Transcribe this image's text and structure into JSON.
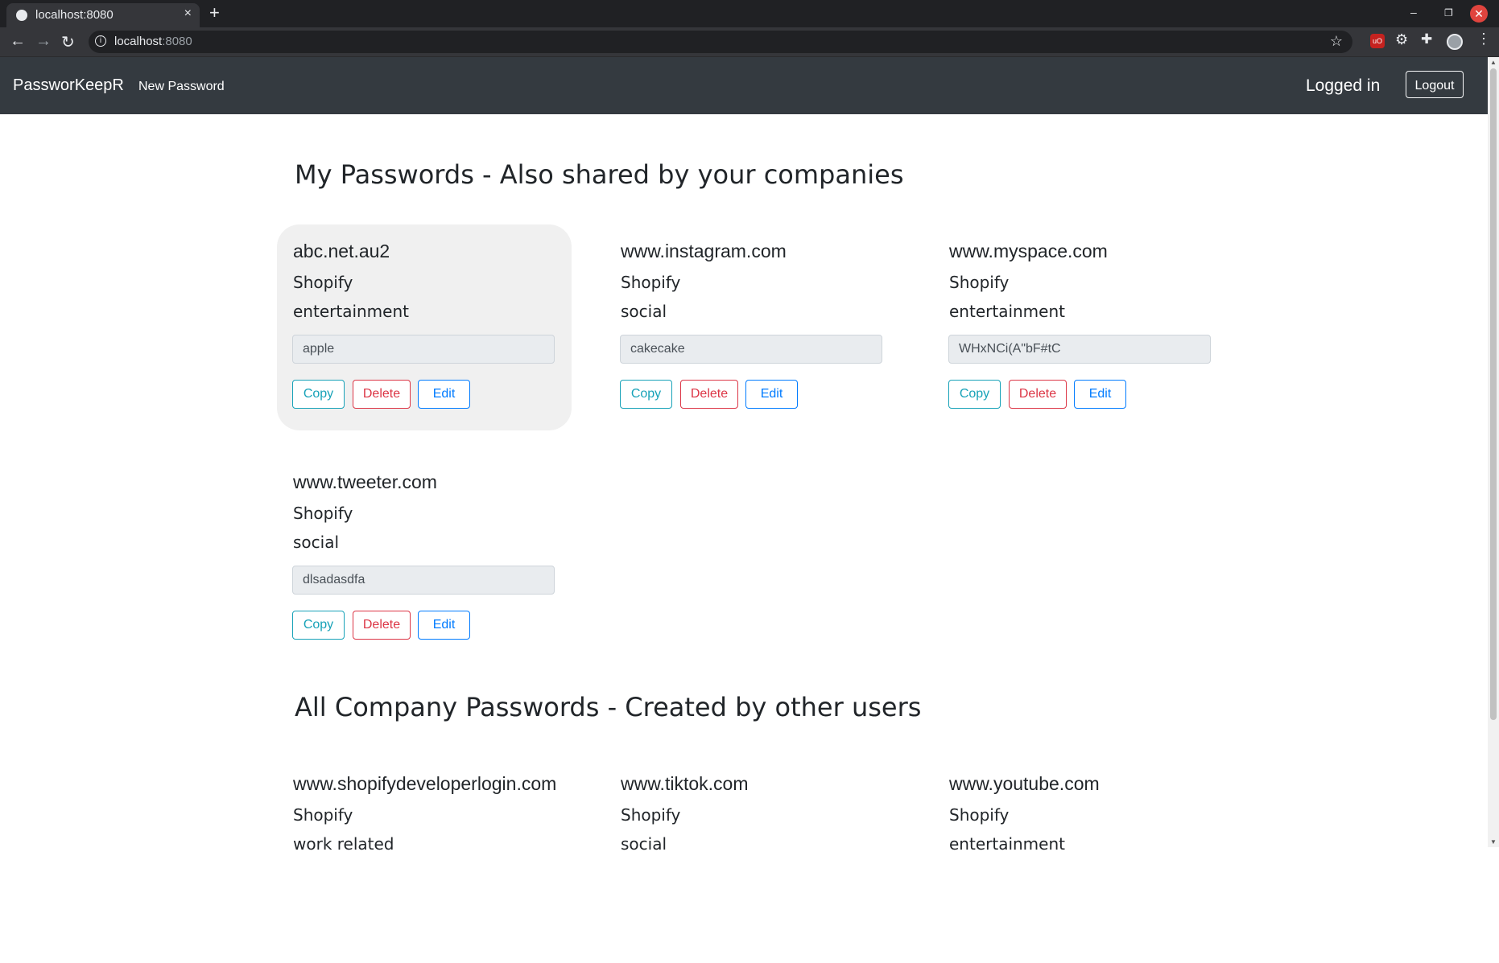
{
  "browser": {
    "tab_title": "localhost:8080",
    "tab_close": "×",
    "new_tab": "+",
    "url_host": "localhost",
    "url_port": ":8080",
    "min": "–",
    "max": "❐",
    "close": "✕",
    "back": "←",
    "forward": "→",
    "reload": "↻",
    "star": "☆",
    "ublock": "uO",
    "gear": "⚙",
    "puzzle": "✚",
    "menu": "⋮"
  },
  "navbar": {
    "brand": "PassworKeepR",
    "new_password": "New Password",
    "status": "Logged in",
    "logout": "Logout"
  },
  "sections": {
    "mine_title": "My Passwords - Also shared by your companies",
    "company_title": "All Company Passwords - Created by other users"
  },
  "buttons": {
    "copy": "Copy",
    "delete": "Delete",
    "edit": "Edit"
  },
  "my_passwords": [
    {
      "site": "abc.net.au2",
      "company": "Shopify",
      "category": "entertainment",
      "password": "apple"
    },
    {
      "site": "www.instagram.com",
      "company": "Shopify",
      "category": "social",
      "password": "cakecake"
    },
    {
      "site": "www.myspace.com",
      "company": "Shopify",
      "category": "entertainment",
      "password": "WHxNCi(A\"bF#tC"
    },
    {
      "site": "www.tweeter.com",
      "company": "Shopify",
      "category": "social",
      "password": "dlsadasdfa"
    }
  ],
  "company_passwords": [
    {
      "site": "www.shopifydeveloperlogin.com",
      "company": "Shopify",
      "category": "work related"
    },
    {
      "site": "www.tiktok.com",
      "company": "Shopify",
      "category": "social"
    },
    {
      "site": "www.youtube.com",
      "company": "Shopify",
      "category": "entertainment"
    }
  ]
}
